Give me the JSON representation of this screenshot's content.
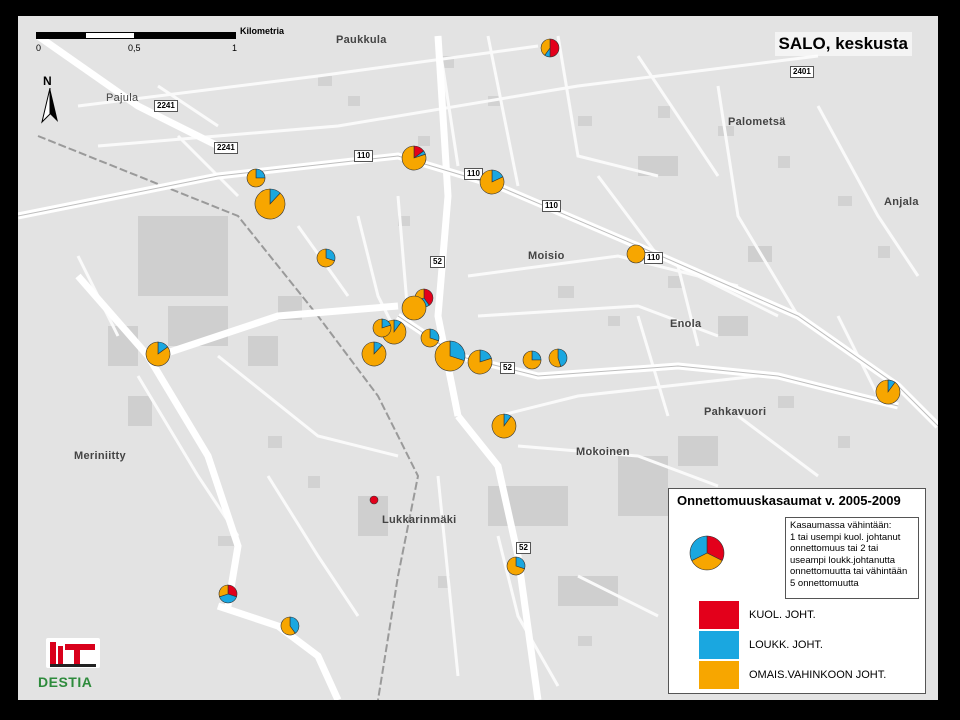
{
  "map": {
    "title": "SALO, keskusta",
    "scale_unit": "Kilometria",
    "scale_ticks": [
      "0",
      "0,5",
      "1"
    ],
    "north_label": "N",
    "place_labels": [
      {
        "text": "Paukkula",
        "key": "paukkula"
      },
      {
        "text": "Pajula",
        "key": "pajula"
      },
      {
        "text": "Palometsä",
        "key": "palometsa"
      },
      {
        "text": "Anjala",
        "key": "anjala"
      },
      {
        "text": "Moisio",
        "key": "moisio"
      },
      {
        "text": "Enola",
        "key": "enola"
      },
      {
        "text": "Pahkavuori",
        "key": "pahkavuori"
      },
      {
        "text": "Meriniitty",
        "key": "meriniitty"
      },
      {
        "text": "Mokoinen",
        "key": "mokoinen"
      },
      {
        "text": "Lukkarinmäki",
        "key": "lukkarinmaki"
      }
    ],
    "road_numbers": [
      "110",
      "110",
      "110",
      "110",
      "52",
      "52",
      "52",
      "2241",
      "2241",
      "2401"
    ]
  },
  "legend": {
    "title": "Onnettomuuskasaumat v. 2005-2009",
    "rule_lines": [
      "Kasaumassa vähintään:",
      "1 tai usempi kuol. johtanut",
      "onnettomuus tai 2 tai",
      "useampi loukk.johtanutta",
      "onnettomuutta tai vähintään",
      "5 onnettomuutta"
    ],
    "categories": [
      {
        "label": "KUOL. JOHT.",
        "color": "#e3001b"
      },
      {
        "label": "LOUKK. JOHT.",
        "color": "#1aa7e0"
      },
      {
        "label": "OMAIS.VAHINKOON JOHT.",
        "color": "#f7a600"
      }
    ]
  },
  "logos": {
    "destia": "DESTIA"
  },
  "clusters": [
    {
      "id": "c1",
      "size": "s",
      "fatal": 0.5,
      "injury": 0.1
    },
    {
      "id": "c2",
      "size": "m",
      "fatal": 0.15,
      "injury": 0.05
    },
    {
      "id": "c3",
      "size": "s",
      "fatal": 0.0,
      "injury": 0.25
    },
    {
      "id": "c4",
      "size": "m",
      "fatal": 0.0,
      "injury": 0.18
    },
    {
      "id": "c5",
      "size": "l",
      "fatal": 0.0,
      "injury": 0.12
    },
    {
      "id": "c6",
      "size": "s",
      "fatal": 0.0,
      "injury": 0.3
    },
    {
      "id": "c7",
      "size": "s",
      "fatal": 0.0,
      "injury": 0.0
    },
    {
      "id": "c8",
      "size": "s",
      "fatal": 0.4,
      "injury": 0.3
    },
    {
      "id": "c9",
      "size": "m",
      "fatal": 0.0,
      "injury": 0.0
    },
    {
      "id": "c10",
      "size": "s",
      "fatal": 0.0,
      "injury": 0.3
    },
    {
      "id": "c11",
      "size": "m",
      "fatal": 0.0,
      "injury": 0.1
    },
    {
      "id": "c12",
      "size": "s",
      "fatal": 0.0,
      "injury": 0.2
    },
    {
      "id": "c13",
      "size": "m",
      "fatal": 0.0,
      "injury": 0.12
    },
    {
      "id": "c14",
      "size": "l",
      "fatal": 0.0,
      "injury": 0.3
    },
    {
      "id": "c15",
      "size": "m",
      "fatal": 0.0,
      "injury": 0.2
    },
    {
      "id": "c16",
      "size": "s",
      "fatal": 0.0,
      "injury": 0.25
    },
    {
      "id": "c17",
      "size": "s",
      "fatal": 0.0,
      "injury": 0.45
    },
    {
      "id": "c18",
      "size": "m",
      "fatal": 0.0,
      "injury": 0.15
    },
    {
      "id": "c19",
      "size": "m",
      "fatal": 0.0,
      "injury": 0.1
    },
    {
      "id": "c20",
      "size": "xs",
      "fatal": 1.0,
      "injury": 0.0
    },
    {
      "id": "c21",
      "size": "s",
      "fatal": 0.0,
      "injury": 0.3
    },
    {
      "id": "c22",
      "size": "s",
      "fatal": 0.3,
      "injury": 0.4
    },
    {
      "id": "c23",
      "size": "s",
      "fatal": 0.0,
      "injury": 0.4
    },
    {
      "id": "c24",
      "size": "m",
      "fatal": 0.0,
      "injury": 0.1
    }
  ]
}
